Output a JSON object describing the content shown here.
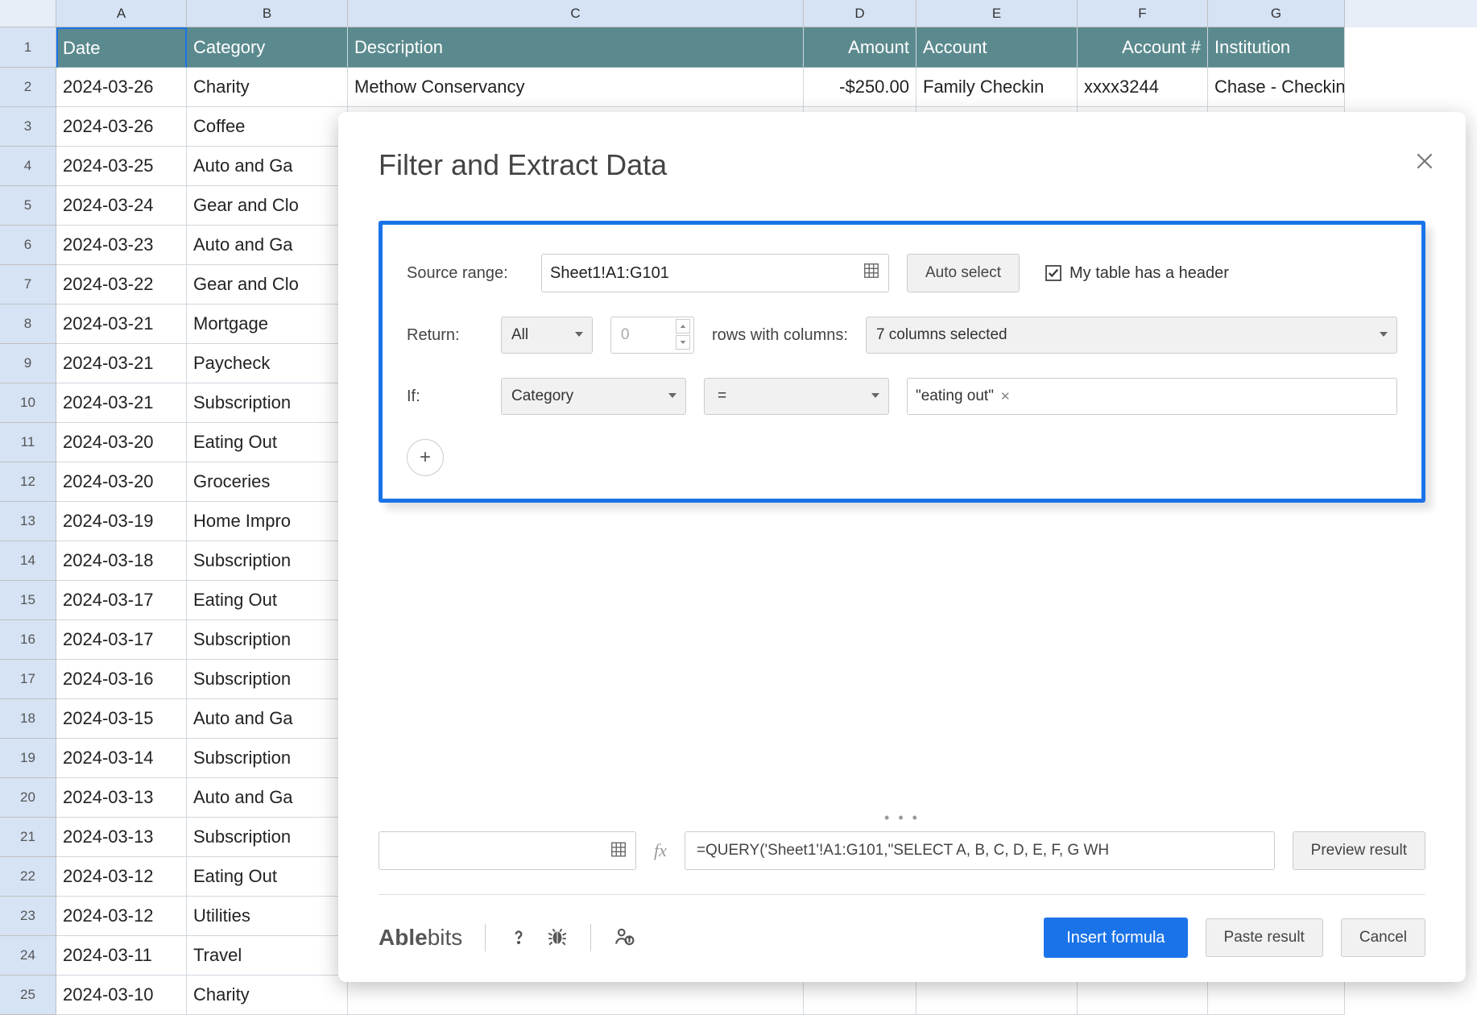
{
  "columns": [
    "A",
    "B",
    "C",
    "D",
    "E",
    "F",
    "G"
  ],
  "header_row": {
    "A": "Date",
    "B": "Category",
    "C": "Description",
    "D": "Amount",
    "E": "Account",
    "F": "Account #",
    "G": "Institution"
  },
  "rows": [
    {
      "A": "2024-03-26",
      "B": "Charity",
      "C": "Methow Conservancy",
      "D": "-$250.00",
      "E": "Family Checkin",
      "F": "xxxx3244",
      "G": "Chase - Checkin"
    },
    {
      "A": "2024-03-26",
      "B": "Coffee"
    },
    {
      "A": "2024-03-25",
      "B": "Auto and Ga"
    },
    {
      "A": "2024-03-24",
      "B": "Gear and Clo"
    },
    {
      "A": "2024-03-23",
      "B": "Auto and Ga"
    },
    {
      "A": "2024-03-22",
      "B": "Gear and Clo"
    },
    {
      "A": "2024-03-21",
      "B": "Mortgage"
    },
    {
      "A": "2024-03-21",
      "B": "Paycheck"
    },
    {
      "A": "2024-03-21",
      "B": "Subscription"
    },
    {
      "A": "2024-03-20",
      "B": "Eating Out"
    },
    {
      "A": "2024-03-20",
      "B": "Groceries"
    },
    {
      "A": "2024-03-19",
      "B": "Home Impro"
    },
    {
      "A": "2024-03-18",
      "B": "Subscription"
    },
    {
      "A": "2024-03-17",
      "B": "Eating Out"
    },
    {
      "A": "2024-03-17",
      "B": "Subscription"
    },
    {
      "A": "2024-03-16",
      "B": "Subscription"
    },
    {
      "A": "2024-03-15",
      "B": "Auto and Ga"
    },
    {
      "A": "2024-03-14",
      "B": "Subscription"
    },
    {
      "A": "2024-03-13",
      "B": "Auto and Ga"
    },
    {
      "A": "2024-03-13",
      "B": "Subscription"
    },
    {
      "A": "2024-03-12",
      "B": "Eating Out"
    },
    {
      "A": "2024-03-12",
      "B": "Utilities"
    },
    {
      "A": "2024-03-11",
      "B": "Travel"
    },
    {
      "A": "2024-03-10",
      "B": "Charity"
    }
  ],
  "modal": {
    "title": "Filter and Extract Data",
    "source_range_label": "Source range:",
    "source_range_value": "Sheet1!A1:G101",
    "auto_select": "Auto select",
    "header_checkbox": "My table has a header",
    "return_label": "Return:",
    "return_value": "All",
    "return_count": "0",
    "rows_with_cols": "rows with columns:",
    "cols_selected": "7 columns selected",
    "if_label": "If:",
    "if_field": "Category",
    "if_operator": "=",
    "if_value": "\"eating out\"",
    "fx": "fx",
    "formula": "=QUERY('Sheet1'!A1:G101,\"SELECT A, B, C, D, E, F, G WH",
    "preview_result": "Preview result",
    "insert_formula": "Insert formula",
    "paste_result": "Paste result",
    "cancel": "Cancel",
    "brand1": "Able",
    "brand2": "bits"
  }
}
